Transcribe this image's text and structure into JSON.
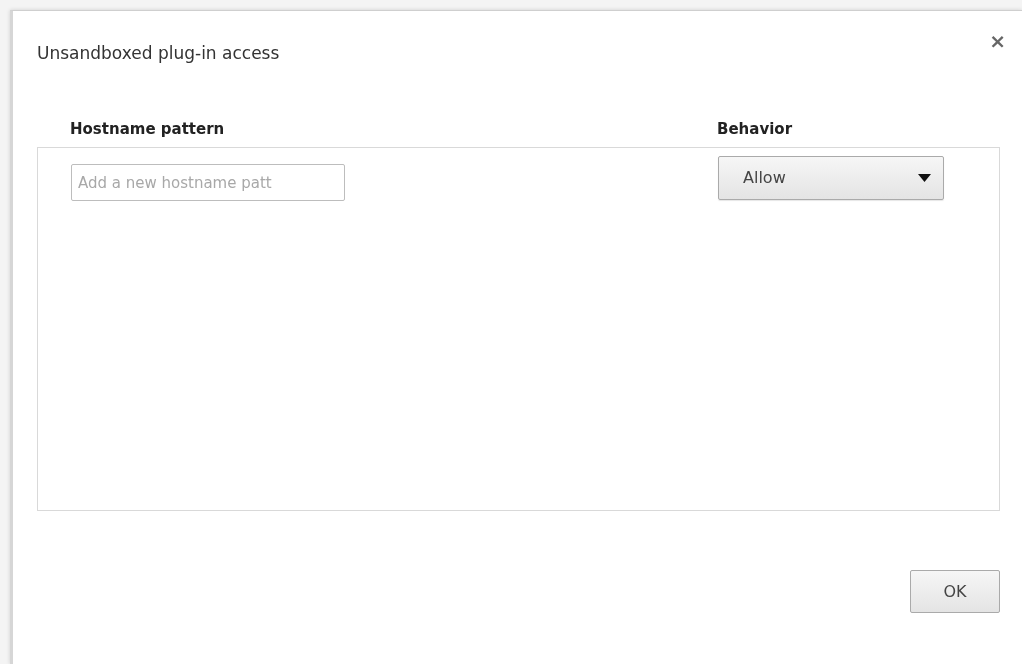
{
  "dialog": {
    "title": "Unsandboxed plug-in access",
    "close": "×"
  },
  "table": {
    "columns": [
      "Hostname pattern",
      "Behavior"
    ],
    "new_row": {
      "pattern": {
        "placeholder": "Add a new hostname patt"
      },
      "behavior": {
        "value": "Allow"
      }
    }
  },
  "buttons": [
    "OK"
  ]
}
